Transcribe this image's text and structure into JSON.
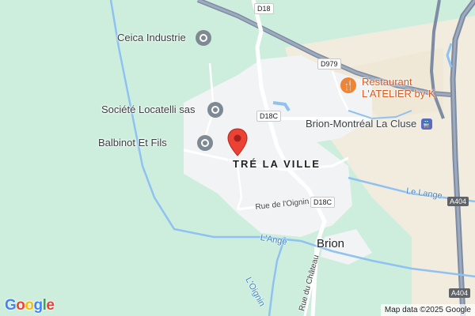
{
  "colors": {
    "terrain": "#cdeedd",
    "town": "#f1f3f4",
    "farmland": "#f2ecdf",
    "water": "#8fc2f0",
    "highway": "#7e8ca3",
    "road": "#ffffff",
    "pin": "#ea4335",
    "restaurant": "#f08431",
    "poi_icon": "#7d8a93"
  },
  "map": {
    "poi": [
      {
        "label": "Ceica Industrie",
        "icon": "poi-circle-icon"
      },
      {
        "label": "Société Locatelli sas",
        "icon": "poi-circle-icon"
      },
      {
        "label": "Balbinot Et Fils",
        "icon": "poi-circle-icon"
      }
    ],
    "restaurant": {
      "line1": "Restaurant",
      "line2": "L'ATELIER by K",
      "icon": "fork-knife-icon"
    },
    "station": {
      "label": "Brion-Montréal La Cluse",
      "icon": "train-station-icon"
    },
    "places": {
      "area": "TRÉ LA VILLE",
      "town": "Brion"
    },
    "shields": {
      "d18": "D18",
      "d979": "D979",
      "d18c_top": "D18C",
      "d18c_bottom": "D18C",
      "a404_top": "A404",
      "a404_bottom": "A404"
    },
    "streets": {
      "rue_oignin": "Rue de l'Oignin",
      "rue_chateau": "Rue du Château"
    },
    "water": {
      "lange_east": "Le Lange",
      "ange": "L'Ange",
      "oignin": "L'Oignin"
    },
    "pin_icon": "location-pin-icon"
  },
  "footer": {
    "logo": [
      "G",
      "o",
      "o",
      "g",
      "l",
      "e"
    ],
    "logo_colors": [
      "#4285f4",
      "#ea4335",
      "#fbbc05",
      "#4285f4",
      "#34a853",
      "#ea4335"
    ],
    "map_data": "Map data ©2025 Google"
  }
}
